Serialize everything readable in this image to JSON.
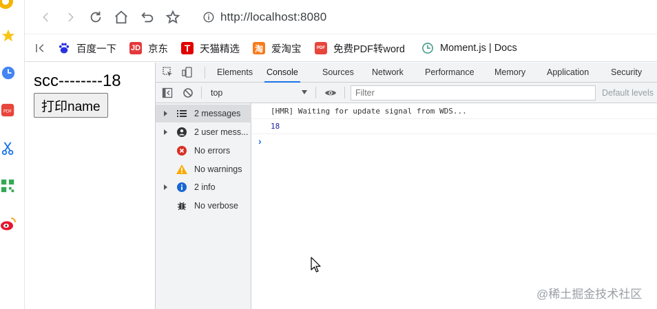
{
  "browser": {
    "url": "http://localhost:8080",
    "bookmarks": [
      {
        "label": "百度一下",
        "icon": "baidu-icon"
      },
      {
        "label": "京东",
        "icon": "jd-icon",
        "icon_text": "JD"
      },
      {
        "label": "天猫精选",
        "icon": "tmall-icon",
        "icon_text": "T"
      },
      {
        "label": "爱淘宝",
        "icon": "taobao-icon",
        "icon_text": "淘"
      },
      {
        "label": "免费PDF转word",
        "icon": "pdf-icon",
        "icon_text": "PDF"
      },
      {
        "label": "Moment.js | Docs",
        "icon": "moment-clock-icon"
      }
    ]
  },
  "page": {
    "text": "scc--------18",
    "button_label": "打印name"
  },
  "devtools": {
    "tabs": [
      "Elements",
      "Console",
      "Sources",
      "Network",
      "Performance",
      "Memory",
      "Application",
      "Security"
    ],
    "active_tab": "Console",
    "context": "top",
    "filter_placeholder": "Filter",
    "levels_label": "Default levels",
    "sidebar": [
      {
        "label": "2 messages",
        "icon": "list-icon",
        "expandable": true
      },
      {
        "label": "2 user mess...",
        "icon": "user-icon",
        "expandable": true
      },
      {
        "label": "No errors",
        "icon": "error-icon",
        "expandable": false
      },
      {
        "label": "No warnings",
        "icon": "warning-icon",
        "expandable": false
      },
      {
        "label": "2 info",
        "icon": "info-icon",
        "expandable": true
      },
      {
        "label": "No verbose",
        "icon": "bug-icon",
        "expandable": false
      }
    ],
    "messages": [
      {
        "text": "[HMR] Waiting for update signal from WDS..."
      },
      {
        "text": "18"
      }
    ]
  },
  "watermark": "@稀土掘金技术社区",
  "colors": {
    "accent": "#1a73e8",
    "error": "#d93025",
    "warning": "#f9ab00",
    "info": "#1967d2"
  }
}
